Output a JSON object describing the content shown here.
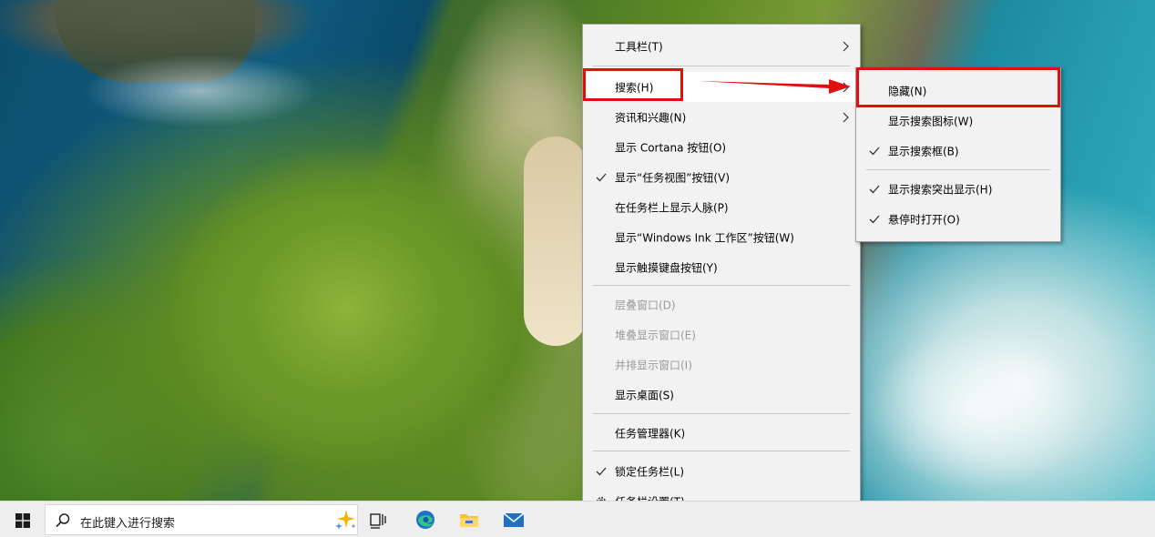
{
  "context_menu": {
    "items": [
      {
        "label": "工具栏(T)",
        "has_submenu": true,
        "checked": false,
        "enabled": true
      },
      {
        "label": "搜索(H)",
        "has_submenu": true,
        "checked": false,
        "enabled": true,
        "highlighted": true
      },
      {
        "label": "资讯和兴趣(N)",
        "has_submenu": true,
        "checked": false,
        "enabled": true
      },
      {
        "label": "显示 Cortana 按钮(O)",
        "has_submenu": false,
        "checked": false,
        "enabled": true
      },
      {
        "label": "显示“任务视图”按钮(V)",
        "has_submenu": false,
        "checked": true,
        "enabled": true
      },
      {
        "label": "在任务栏上显示人脉(P)",
        "has_submenu": false,
        "checked": false,
        "enabled": true
      },
      {
        "label": "显示“Windows Ink 工作区”按钮(W)",
        "has_submenu": false,
        "checked": false,
        "enabled": true
      },
      {
        "label": "显示触摸键盘按钮(Y)",
        "has_submenu": false,
        "checked": false,
        "enabled": true
      },
      {
        "label": "层叠窗口(D)",
        "has_submenu": false,
        "checked": false,
        "enabled": false
      },
      {
        "label": "堆叠显示窗口(E)",
        "has_submenu": false,
        "checked": false,
        "enabled": false
      },
      {
        "label": "并排显示窗口(I)",
        "has_submenu": false,
        "checked": false,
        "enabled": false
      },
      {
        "label": "显示桌面(S)",
        "has_submenu": false,
        "checked": false,
        "enabled": true
      },
      {
        "label": "任务管理器(K)",
        "has_submenu": false,
        "checked": false,
        "enabled": true
      },
      {
        "label": "锁定任务栏(L)",
        "has_submenu": false,
        "checked": true,
        "enabled": true
      },
      {
        "label": "任务栏设置(T)",
        "has_submenu": false,
        "checked": false,
        "enabled": true,
        "icon": "gear-icon"
      }
    ]
  },
  "search_submenu": {
    "items": [
      {
        "label": "隐藏(N)",
        "checked": false
      },
      {
        "label": "显示搜索图标(W)",
        "checked": false
      },
      {
        "label": "显示搜索框(B)",
        "checked": true
      },
      {
        "label": "显示搜索突出显示(H)",
        "checked": true
      },
      {
        "label": "悬停时打开(O)",
        "checked": true
      }
    ]
  },
  "annotation": {
    "color": "#e01010"
  },
  "taskbar": {
    "search_placeholder": "在此键入进行搜索",
    "icons": [
      "windows-start-icon",
      "search-icon",
      "sparkle-icon",
      "task-view-icon",
      "edge-icon",
      "file-explorer-icon",
      "mail-icon"
    ]
  }
}
